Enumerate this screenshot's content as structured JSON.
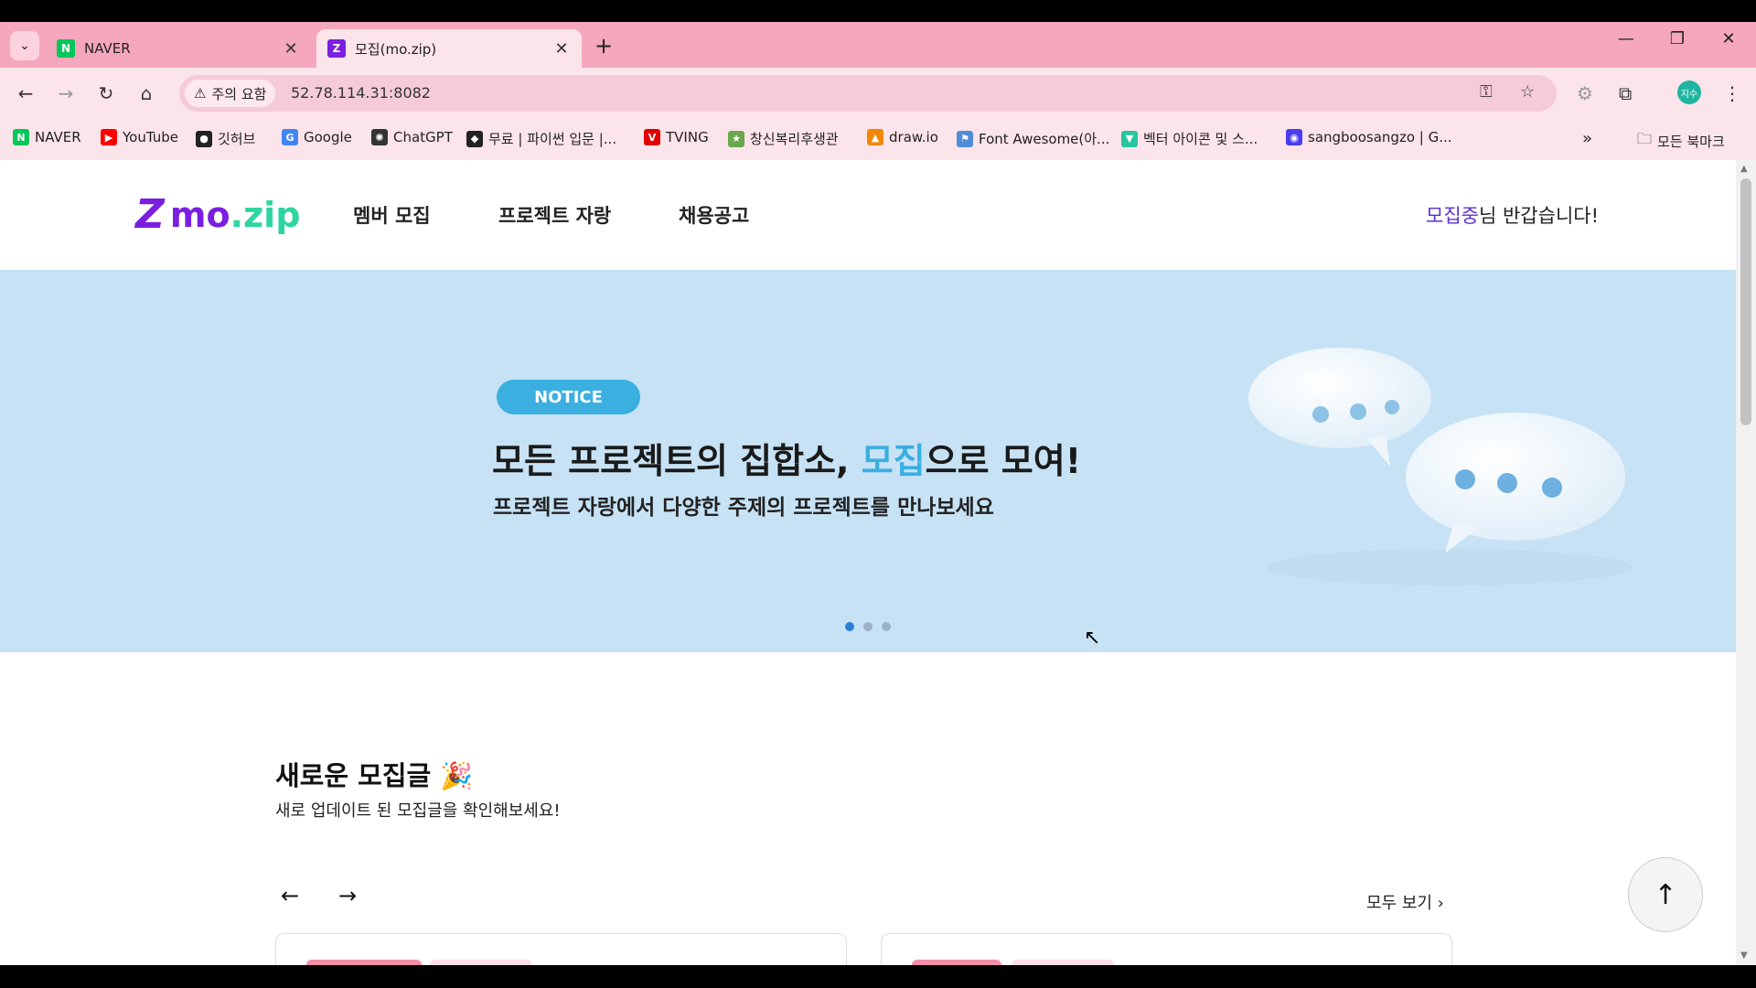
{
  "browser": {
    "tabs": [
      {
        "label": "NAVER",
        "favicon": "N",
        "active": false
      },
      {
        "label": "모집(mo.zip)",
        "favicon": "Z",
        "active": true
      }
    ],
    "new_tab": "+",
    "window_controls": {
      "minimize": "—",
      "maximize": "❐",
      "close": "✕"
    },
    "security_label": "주의 요함",
    "url": "52.78.114.31:8082",
    "profile_initials": "지수"
  },
  "bookmarks": [
    {
      "label": "NAVER",
      "icon": "N",
      "color": "#03c75a"
    },
    {
      "label": "YouTube",
      "icon": "▶",
      "color": "#ff0000"
    },
    {
      "label": "깃허브",
      "icon": "●",
      "color": "#222222"
    },
    {
      "label": "Google",
      "icon": "G",
      "color": "#4285f4"
    },
    {
      "label": "ChatGPT",
      "icon": "✺",
      "color": "#333333"
    },
    {
      "label": "무료 | 파이썬 입문 |...",
      "icon": "◆",
      "color": "#222222"
    },
    {
      "label": "TVING",
      "icon": "V",
      "color": "#e00000"
    },
    {
      "label": "창신복리후생관",
      "icon": "★",
      "color": "#6aa84f"
    },
    {
      "label": "draw.io",
      "icon": "▲",
      "color": "#f08705"
    },
    {
      "label": "Font Awesome(아...",
      "icon": "⚑",
      "color": "#528dd7"
    },
    {
      "label": "벡터 아이콘 및 스...",
      "icon": "▼",
      "color": "#28c5a0"
    },
    {
      "label": "sangboosangzo | G...",
      "icon": "◉",
      "color": "#4a3df0"
    }
  ],
  "bookmarks_overflow": "»",
  "all_bookmarks": "모든 북마크",
  "site": {
    "logo_mark": "Z",
    "logo_text_main": "mo",
    "logo_text_sub": ".zip",
    "nav": [
      "멤버 모집",
      "프로젝트 자랑",
      "채용공고"
    ],
    "greeting_name": "모집중",
    "greeting_rest": "님 반갑습니다!"
  },
  "hero": {
    "badge": "NOTICE",
    "title_pre": "모든 프로젝트의 집합소, ",
    "title_highlight": "모집",
    "title_post": "으로 모여!",
    "subtitle": "프로젝트 자랑에서 다양한 주제의 프로젝트를 만나보세요",
    "slides": 3,
    "active_slide": 0
  },
  "recent": {
    "title": "새로운 모집글",
    "emoji": "🎉",
    "subtitle": "새로 업데이트 된 모집글을 확인해보세요!",
    "prev": "←",
    "next": "→",
    "view_all": "모두 보기 ›"
  },
  "scroll_top": "↑",
  "colors": {
    "tab_bar": "#f4a7bd",
    "brand_purple": "#7a1fe0",
    "brand_green": "#2ed5a0",
    "hero_bg": "#c7e2f5",
    "notice_blue": "#3aafe0"
  }
}
